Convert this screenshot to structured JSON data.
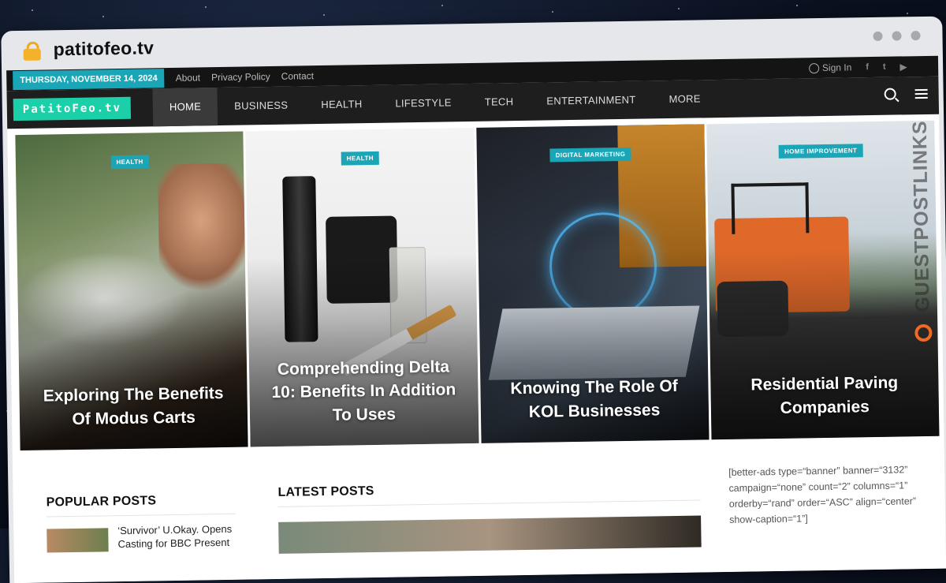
{
  "browser": {
    "url": "patitofeo.tv"
  },
  "topbar": {
    "date": "THURSDAY, NOVEMBER 14, 2024",
    "links": [
      "About",
      "Privacy Policy",
      "Contact"
    ],
    "sign_in": "Sign In",
    "social": [
      "f",
      "t",
      "▶"
    ]
  },
  "navbar": {
    "logo": "PatitoFeo.tv",
    "menu": [
      "HOME",
      "BUSINESS",
      "HEALTH",
      "LIFESTYLE",
      "TECH",
      "ENTERTAINMENT",
      "MORE"
    ],
    "active": "HOME"
  },
  "hero": [
    {
      "category": "HEALTH",
      "title": "Exploring The Benefits Of Modus Carts"
    },
    {
      "category": "HEALTH",
      "title": "Comprehending Delta 10: Benefits In Addition To Uses"
    },
    {
      "category": "DIGITAL MARKETING",
      "title": "Knowing The Role Of KOL Businesses"
    },
    {
      "category": "HOME IMPROVEMENT",
      "title": "Residential Paving Companies"
    }
  ],
  "sidebar": {
    "popular_title": "POPULAR POSTS",
    "popular_first": "‘Survivor’ U.Okay. Opens Casting for BBC Present"
  },
  "main": {
    "latest_title": "LATEST POSTS"
  },
  "ads_shortcode": "[better-ads type=“banner” banner=“3132” campaign=“none” count=“2” columns=“1” orderby=“rand” order=“ASC” align=“center” show-caption=“1”]",
  "watermark": "GUESTPOSTLINKS"
}
